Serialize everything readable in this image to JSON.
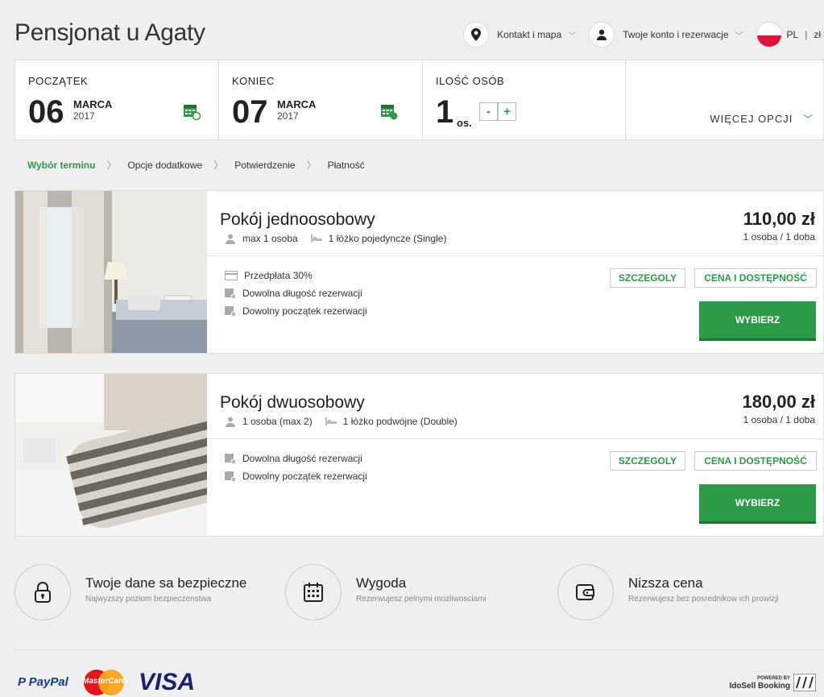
{
  "header": {
    "title": "Pensjonat u Agaty",
    "contact_label": "Kontakt i mapa",
    "account_label": "Twoje konto i rezerwacje",
    "lang_label": "PL",
    "currency_label": "zł"
  },
  "dates": {
    "start_label": "POCZĄTEK",
    "start_day": "06",
    "start_month": "MARCA",
    "start_year": "2017",
    "end_label": "KONIEC",
    "end_day": "07",
    "end_month": "MARCA",
    "end_year": "2017",
    "guests_label": "ILOŚĆ OSÓB",
    "guests_count": "1",
    "guests_unit": "os.",
    "minus": "-",
    "plus": "+",
    "more_options": "WIĘCEJ OPCJI"
  },
  "breadcrumb": {
    "steps": [
      "Wybór terminu",
      "Opcje dodatkowe",
      "Potwierdzenie",
      "Płatność"
    ]
  },
  "rooms": [
    {
      "title": "Pokój jednoosobowy",
      "capacity": "max 1 osoba",
      "bed": "1 łóżko pojedyncze (Single)",
      "price": "110,00 zł",
      "price_sub": "1 osoba / 1 doba",
      "features": [
        "Przedpłata 30%",
        "Dowolna długość rezerwacji",
        "Dowolny początek rezerwacji"
      ],
      "details_label": "SZCZEGOLY",
      "availability_label": "CENA I DOSTĘPNOŚĆ",
      "select_label": "WYBIERZ"
    },
    {
      "title": "Pokój dwuosobowy",
      "capacity": "1 osoba (max 2)",
      "bed": "1 łóżko podwójne (Double)",
      "price": "180,00 zł",
      "price_sub": "1 osoba / 1 doba",
      "features": [
        "Dowolna długość rezerwacji",
        "Dowolny początek rezerwacji"
      ],
      "details_label": "SZCZEGOLY",
      "availability_label": "CENA I DOSTĘPNOŚĆ",
      "select_label": "WYBIERZ"
    }
  ],
  "benefits": [
    {
      "title": "Twoje dane sa bezpieczne",
      "subtitle": "Najwyzszy poziom bezpieczenstwa",
      "icon": "lock-icon"
    },
    {
      "title": "Wygoda",
      "subtitle": "Rezerwujesz pelnymi mozliwosciami",
      "icon": "calendar-icon"
    },
    {
      "title": "Nizsza cena",
      "subtitle": "Rezerwujesz bez posrednikow ich prowizji",
      "icon": "wallet-icon"
    }
  ],
  "footer": {
    "paypal": "PayPal",
    "mastercard": "MasterCard",
    "visa": "VISA",
    "powered_by": "POWERED BY",
    "powered_brand": "IdoSell Booking"
  },
  "colors": {
    "accent": "#2d9a47",
    "background": "#efefef"
  }
}
